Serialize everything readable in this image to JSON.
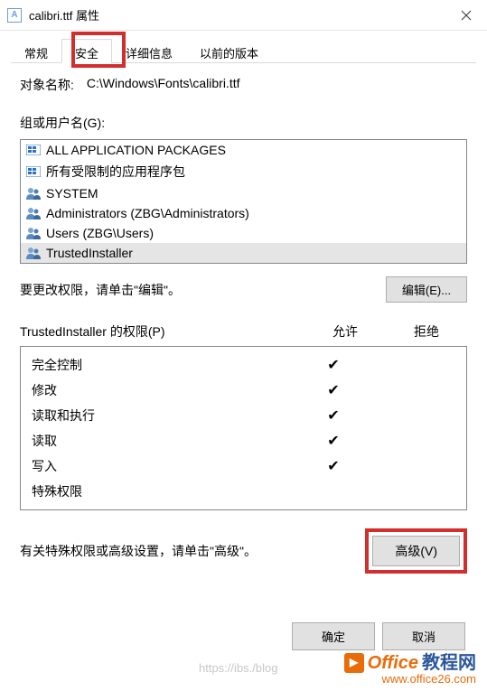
{
  "titlebar": {
    "title": "calibri.ttf 属性"
  },
  "tabs": [
    "常规",
    "安全",
    "详细信息",
    "以前的版本"
  ],
  "objectRow": {
    "label": "对象名称:",
    "value": "C:\\Windows\\Fonts\\calibri.ttf"
  },
  "groupLabel": "组或用户名(G):",
  "principals": [
    "ALL APPLICATION PACKAGES",
    "所有受限制的应用程序包",
    "SYSTEM",
    "Administrators (ZBG\\Administrators)",
    "Users (ZBG\\Users)",
    "TrustedInstaller"
  ],
  "editRow": {
    "text": "要更改权限，请单击\"编辑\"。",
    "button": "编辑(E)..."
  },
  "permHeader": {
    "name": "TrustedInstaller 的权限(P)",
    "allow": "允许",
    "deny": "拒绝"
  },
  "permissions": [
    {
      "name": "完全控制",
      "allow": true,
      "deny": false
    },
    {
      "name": "修改",
      "allow": true,
      "deny": false
    },
    {
      "name": "读取和执行",
      "allow": true,
      "deny": false
    },
    {
      "name": "读取",
      "allow": true,
      "deny": false
    },
    {
      "name": "写入",
      "allow": true,
      "deny": false
    },
    {
      "name": "特殊权限",
      "allow": false,
      "deny": false
    }
  ],
  "advRow": {
    "text": "有关特殊权限或高级设置，请单击\"高级\"。",
    "button": "高级(V)"
  },
  "footer": {
    "ok": "确定",
    "cancel": "取消"
  },
  "watermark": {
    "brand1": "Office",
    "brand2": "教程网",
    "url": "www.office26.com"
  },
  "ghost": "https://ibs./blog"
}
